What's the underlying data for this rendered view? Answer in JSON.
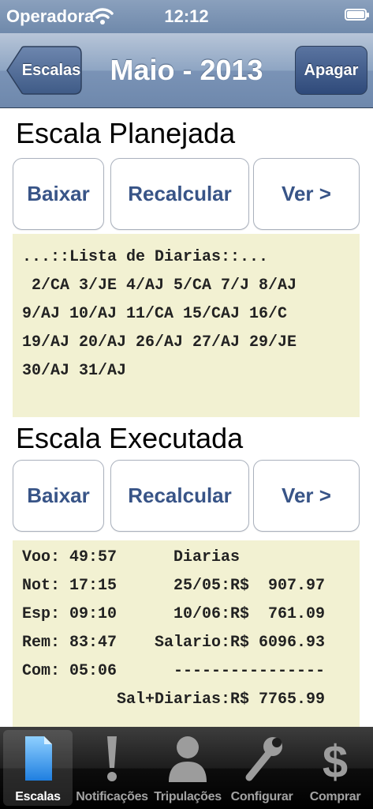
{
  "status_bar": {
    "carrier": "Operadora",
    "time": "12:12"
  },
  "nav": {
    "back_label": "Escalas",
    "title": "Maio - 2013",
    "right_label": "Apagar"
  },
  "planned": {
    "heading": "Escala Planejada",
    "buttons": {
      "download": "Baixar",
      "recalc": "Recalcular",
      "view": "Ver >"
    },
    "lines": [
      "...::Lista de Diarias::...",
      " 2/CA 3/JE 4/AJ 5/CA 7/J 8/AJ",
      "9/AJ 10/AJ 11/CA 15/CAJ 16/C",
      "19/AJ 20/AJ 26/AJ 27/AJ 29/JE",
      "30/AJ 31/AJ"
    ]
  },
  "executed": {
    "heading": "Escala Executada",
    "buttons": {
      "download": "Baixar",
      "recalc": "Recalcular",
      "view": "Ver >"
    },
    "lines": [
      "Voo: 49:57      Diarias",
      "Not: 17:15      25/05:R$  907.97",
      "Esp: 09:10      10/06:R$  761.09",
      "Rem: 83:47    Salario:R$ 6096.93",
      "Com: 05:06      ----------------",
      "          Sal+Diarias:R$ 7765.99"
    ]
  },
  "tabbar": {
    "tabs": [
      {
        "label": "Escalas",
        "icon": "document-icon"
      },
      {
        "label": "Notificações",
        "icon": "exclamation-icon"
      },
      {
        "label": "Tripulações",
        "icon": "person-icon"
      },
      {
        "label": "Configurar",
        "icon": "wrench-icon"
      },
      {
        "label": "Comprar",
        "icon": "dollar-icon"
      }
    ]
  },
  "colors": {
    "nav_bar": "#7a93b6",
    "button_text": "#385487",
    "panel_bg": "#f2f1d2",
    "tab_bar": "#1d1d1d"
  }
}
